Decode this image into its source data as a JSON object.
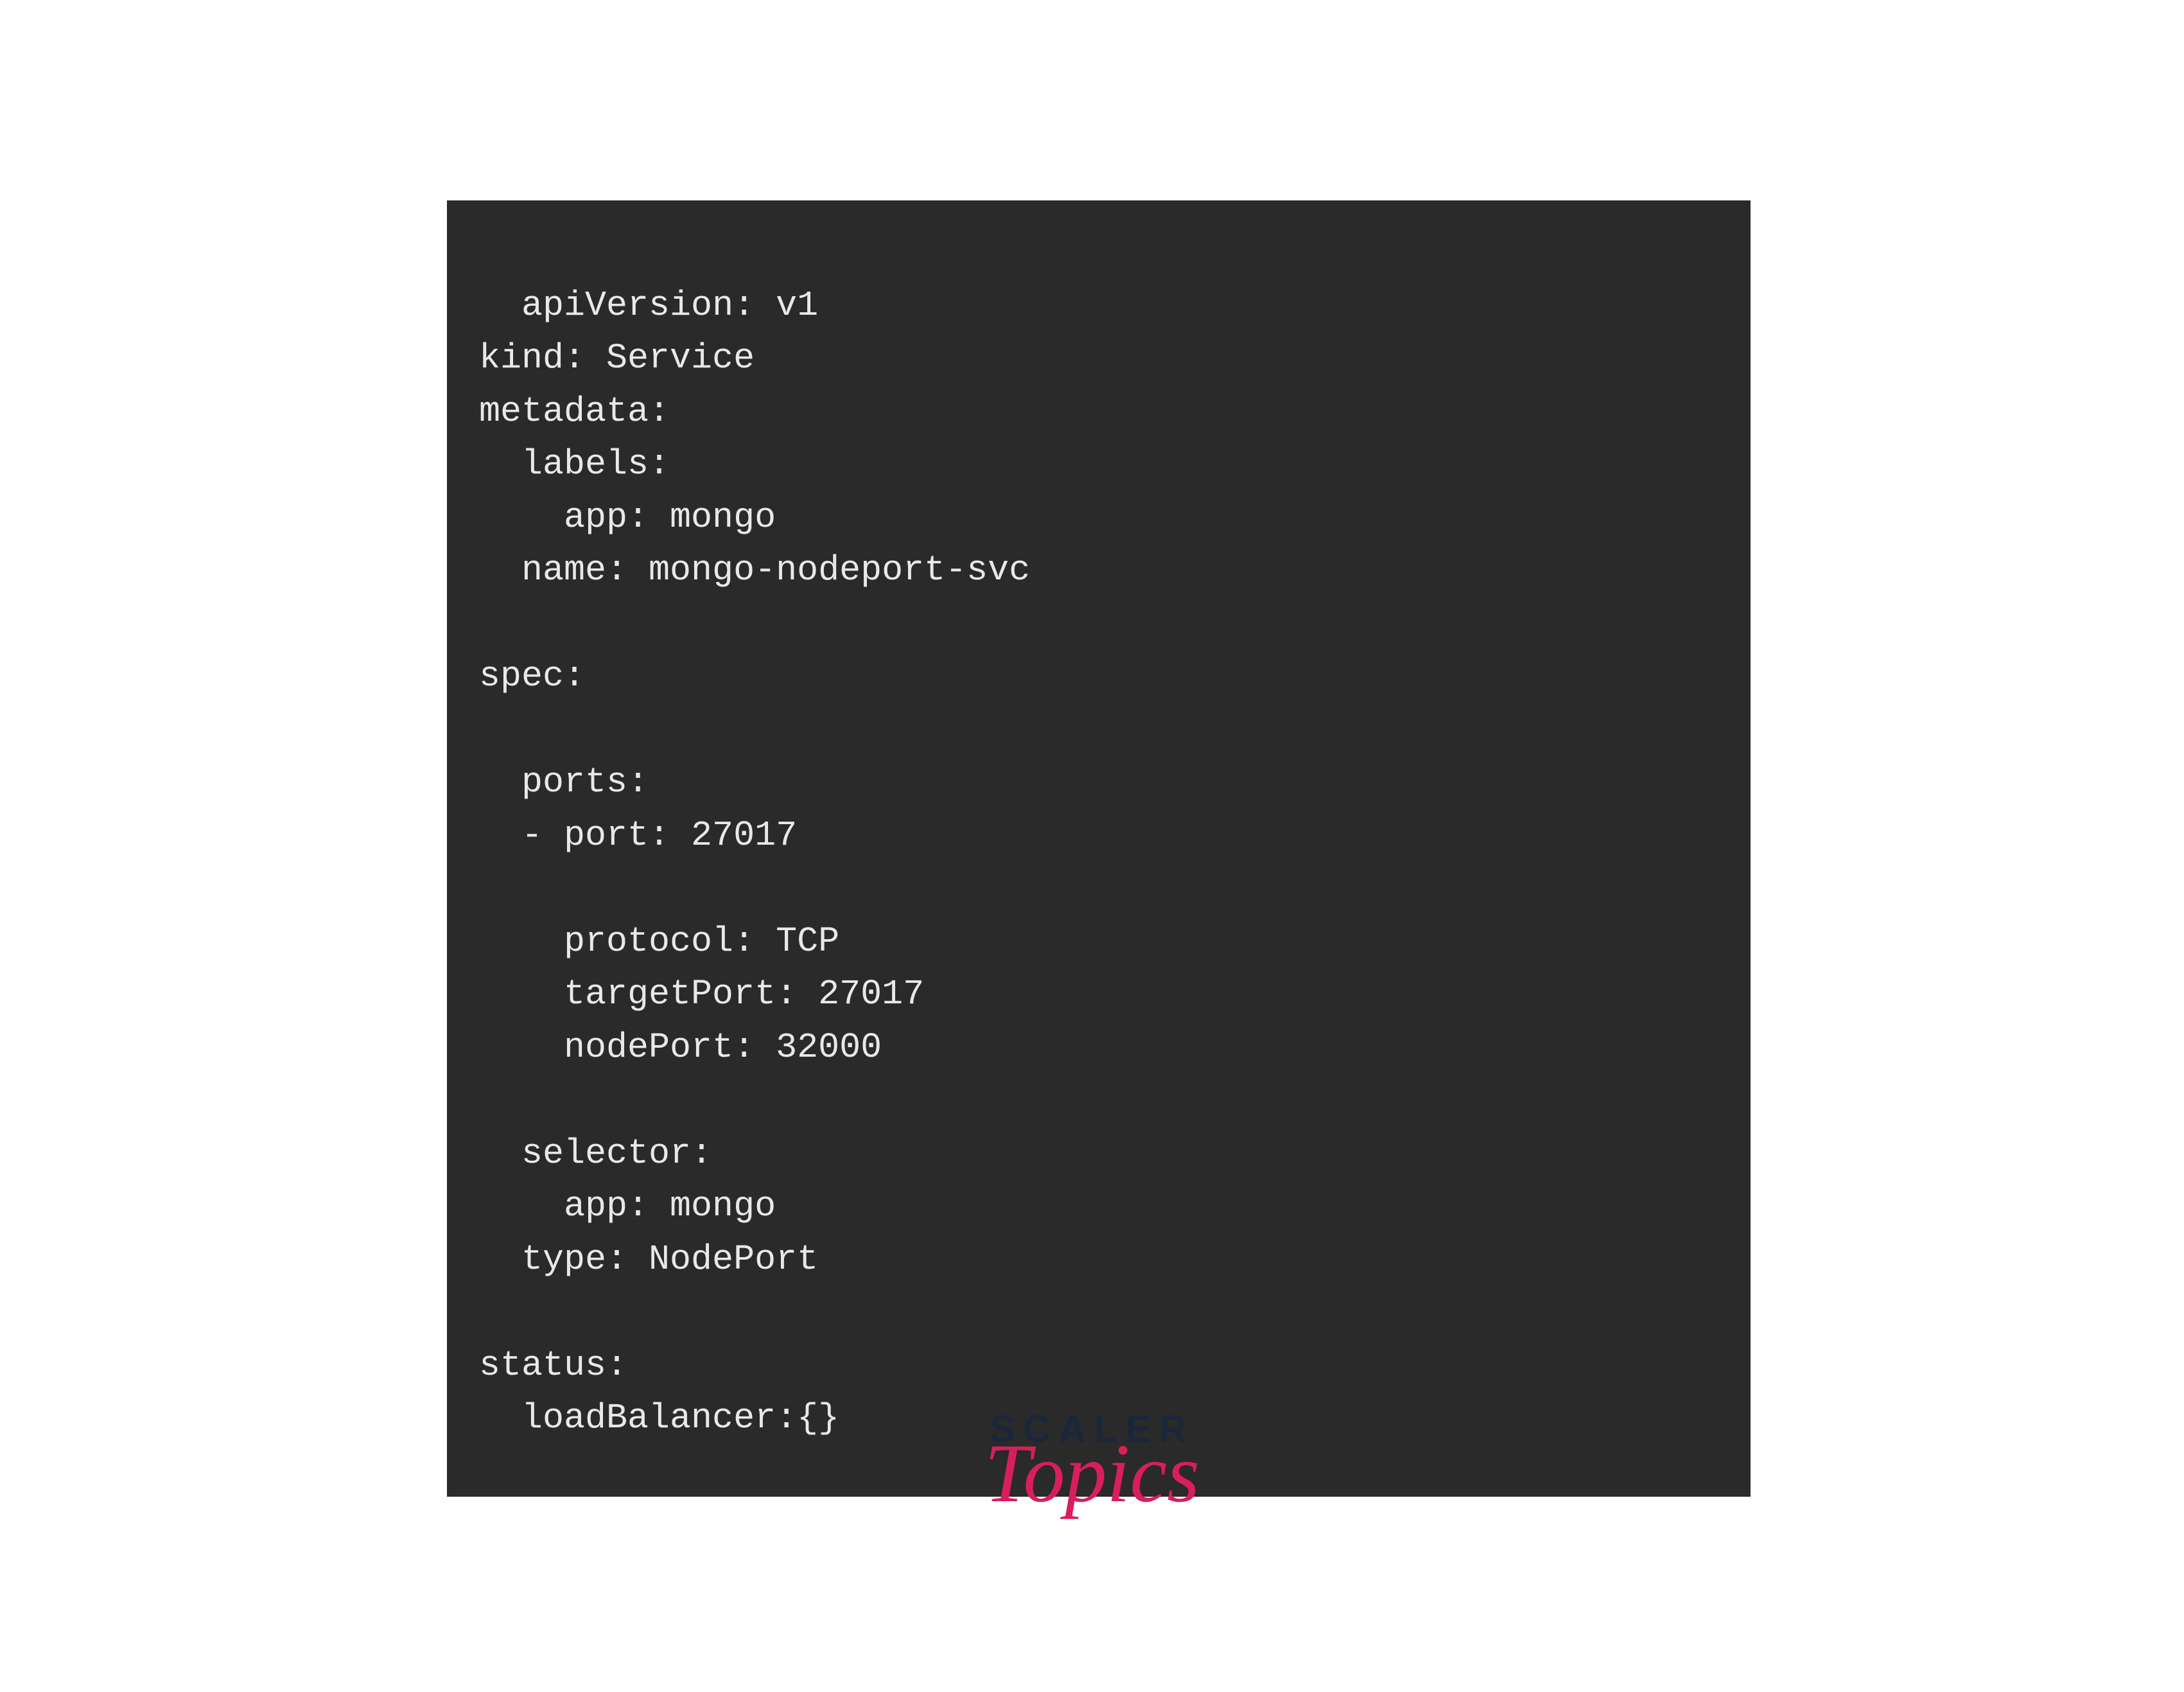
{
  "code": {
    "lines": [
      "apiVersion: v1",
      "kind: Service",
      "metadata:",
      "  labels:",
      "    app: mongo",
      "  name: mongo-nodeport-svc",
      "",
      "spec:",
      "",
      "  ports:",
      "  - port: 27017",
      "",
      "    protocol: TCP",
      "    targetPort: 27017",
      "    nodePort: 32000",
      "",
      "  selector:",
      "    app: mongo",
      "  type: NodePort",
      "",
      "status:",
      "  loadBalancer:{}"
    ]
  },
  "logo": {
    "brand": "SCALER",
    "subbrand": "Topics"
  }
}
